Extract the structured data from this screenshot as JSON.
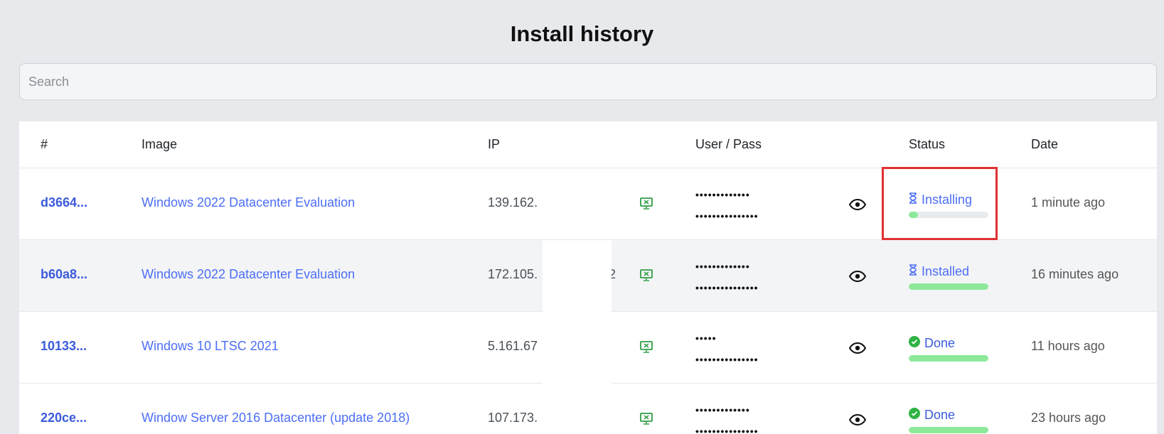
{
  "page": {
    "title": "Install history"
  },
  "search": {
    "placeholder": "Search",
    "value": ""
  },
  "table": {
    "headers": {
      "id": "#",
      "image": "Image",
      "ip": "IP",
      "user_pass": "User / Pass",
      "status": "Status",
      "date": "Date"
    },
    "rows": [
      {
        "id": "d3664...",
        "image": "Windows 2022 Datacenter Evaluation",
        "ip": "139.162.",
        "ip_suffix": "",
        "user": "•••••••••••••",
        "pass": "•••••••••••••••",
        "status": "Installing",
        "status_icon": "hourglass-icon",
        "progress": 0.12,
        "date": "1 minute ago"
      },
      {
        "id": "b60a8...",
        "image": "Windows 2022 Datacenter Evaluation",
        "ip": "172.105.",
        "ip_suffix": "2",
        "user": "•••••••••••••",
        "pass": "•••••••••••••••",
        "status": "Installed",
        "status_icon": "hourglass-icon",
        "progress": 1.0,
        "date": "16 minutes ago"
      },
      {
        "id": "10133...",
        "image": "Windows 10 LTSC 2021",
        "ip": "5.161.67",
        "ip_suffix": "",
        "user": "•••••",
        "pass": "•••••••••••••••",
        "status": "Done",
        "status_icon": "check-circle-icon",
        "progress": 1.0,
        "date": "11 hours ago"
      },
      {
        "id": "220ce...",
        "image": "Window Server 2016 Datacenter (update 2018)",
        "ip": "107.173.",
        "ip_suffix": "",
        "user": "•••••••••••••",
        "pass": "•••••••••••••••",
        "status": "Done",
        "status_icon": "check-circle-icon",
        "progress": 1.0,
        "date": "23 hours ago"
      }
    ]
  },
  "colors": {
    "accent": "#4c6ef5",
    "progress": "#8ce99a",
    "done": "#2fb344",
    "highlight": "#e03131",
    "monitor_icon": "#2f9e44"
  }
}
